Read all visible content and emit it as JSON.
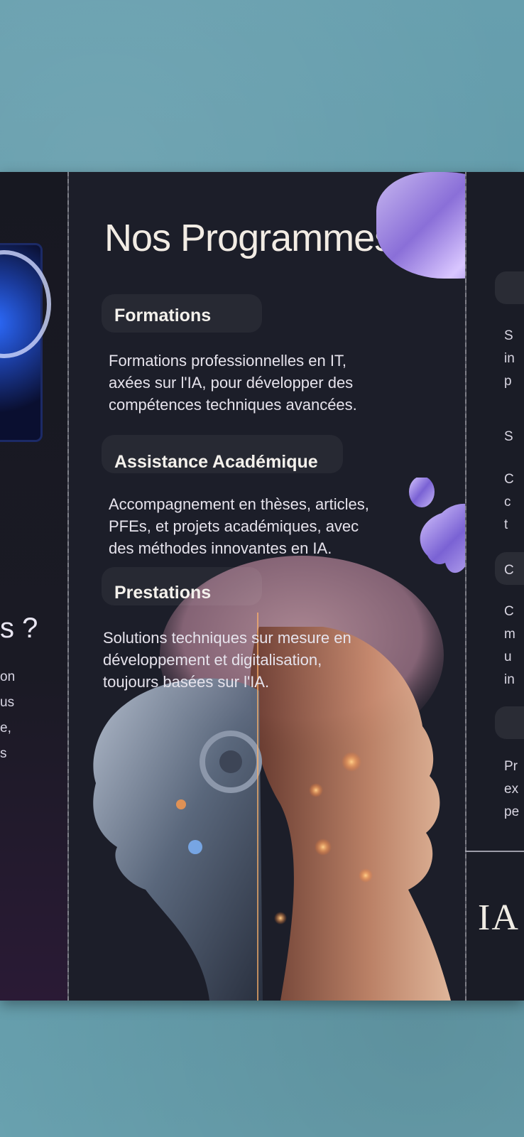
{
  "main": {
    "title": "Nos Programmes :",
    "sections": [
      {
        "title": "Formations",
        "lines": [
          "Formations professionnelles en IT,",
          "axées sur l'IA, pour développer des",
          "compétences techniques avancées."
        ]
      },
      {
        "title": "Assistance Académique",
        "lines": [
          "Accompagnement en thèses, articles,",
          "PFEs, et projets académiques, avec",
          "des méthodes innovantes en IA."
        ]
      },
      {
        "title": "Prestations",
        "lines": [
          "Solutions techniques sur mesure en",
          "développement et digitalisation,",
          "toujours basées sur l'IA."
        ]
      }
    ]
  },
  "left_panel": {
    "heading_fragment": "s ?",
    "fragments": [
      "on",
      "us",
      "e,",
      "s"
    ]
  },
  "right_panel": {
    "fragments": [
      "S",
      "in",
      "p",
      "S",
      "C",
      "c",
      "t",
      "C",
      "C",
      "m",
      "u",
      "in",
      "Pr",
      "ex",
      "pe"
    ],
    "logo": "IA"
  },
  "colors": {
    "brochure_bg": "#1c1e29",
    "title_text": "#f2ece4",
    "body_text": "#e6e3ec",
    "background_carpet": "#5f9aa8"
  }
}
